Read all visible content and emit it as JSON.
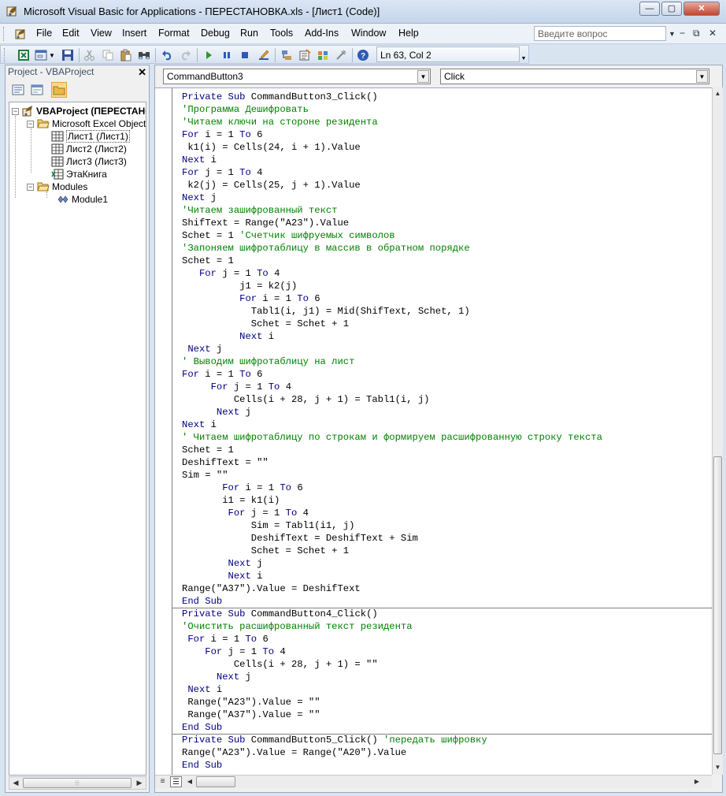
{
  "window": {
    "title": "Microsoft Visual Basic for Applications - ПЕРЕСТАНОВКА.xls - [Лист1 (Code)]",
    "minimize": "—",
    "maximize": "▢",
    "close": "✕"
  },
  "menu": {
    "items": [
      {
        "label": "File",
        "name": "menu-file"
      },
      {
        "label": "Edit",
        "name": "menu-edit"
      },
      {
        "label": "View",
        "name": "menu-view"
      },
      {
        "label": "Insert",
        "name": "menu-insert"
      },
      {
        "label": "Format",
        "name": "menu-format"
      },
      {
        "label": "Debug",
        "name": "menu-debug"
      },
      {
        "label": "Run",
        "name": "menu-run"
      },
      {
        "label": "Tools",
        "name": "menu-tools"
      },
      {
        "label": "Add-Ins",
        "name": "menu-addins"
      },
      {
        "label": "Window",
        "name": "menu-window"
      },
      {
        "label": "Help",
        "name": "menu-help"
      }
    ],
    "ask_placeholder": "Введите вопрос",
    "mdi_minimize": "−",
    "mdi_restore": "⧉",
    "mdi_close": "✕"
  },
  "toolbar": {
    "status": "Ln 63, Col 2"
  },
  "project": {
    "title": "Project - VBAProject",
    "close": "✕",
    "tree": {
      "root": "VBAProject (ПЕРЕСТАНОВКА.xls)",
      "excel_objects": "Microsoft Excel Objects",
      "sheet1": "Лист1 (Лист1)",
      "sheet2": "Лист2 (Лист2)",
      "sheet3": "Лист3 (Лист3)",
      "workbook": "ЭтаКнига",
      "modules": "Modules",
      "module1": "Module1"
    }
  },
  "code": {
    "object_select": "CommandButton3",
    "proc_select": "Click",
    "lines": [
      [
        "Private Sub CommandButton3_Click()"
      ],
      [
        "'Программа Дешифровать"
      ],
      [
        "'Читаем ключи на стороне резидента"
      ],
      [
        "For i = 1 To 6"
      ],
      [
        " k1(i) = Cells(24, i + 1).Value"
      ],
      [
        "Next i"
      ],
      [
        "For j = 1 To 4"
      ],
      [
        " k2(j) = Cells(25, j + 1).Value"
      ],
      [
        "Next j"
      ],
      [
        "'Читаем зашифрованный текст"
      ],
      [
        "ShifText = Range(\"A23\").Value"
      ],
      [
        "Schet = 1 'Счетчик шифруемых символов"
      ],
      [
        "'Запоняем шифротаблицу в массив в обратном порядке"
      ],
      [
        "Schet = 1"
      ],
      [
        "   For j = 1 To 4"
      ],
      [
        "          j1 = k2(j)"
      ],
      [
        "          For i = 1 To 6"
      ],
      [
        "            Tabl1(i, j1) = Mid(ShifText, Schet, 1)"
      ],
      [
        "            Schet = Schet + 1"
      ],
      [
        "          Next i"
      ],
      [
        " Next j"
      ],
      [
        "' Выводим шифротаблицу на лист"
      ],
      [
        "For i = 1 To 6"
      ],
      [
        "     For j = 1 To 4"
      ],
      [
        "         Cells(i + 28, j + 1) = Tabl1(i, j)"
      ],
      [
        "      Next j"
      ],
      [
        "Next i"
      ],
      [
        "' Читаем шифротаблицу по строкам и формируем расшифрованную строку текста"
      ],
      [
        "Schet = 1"
      ],
      [
        "DeshifText = \"\""
      ],
      [
        "Sim = \"\""
      ],
      [
        "       For i = 1 To 6"
      ],
      [
        "       i1 = k1(i)"
      ],
      [
        "        For j = 1 To 4"
      ],
      [
        "            Sim = Tabl1(i1, j)"
      ],
      [
        "            DeshifText = DeshifText + Sim"
      ],
      [
        "            Schet = Schet + 1"
      ],
      [
        "        Next j"
      ],
      [
        "        Next i"
      ],
      [
        "Range(\"A37\").Value = DeshifText"
      ],
      [
        "End Sub"
      ],
      [
        "Private Sub CommandButton4_Click()"
      ],
      [
        "'Очистить расшифрованный текст резидента"
      ],
      [
        " For i = 1 To 6"
      ],
      [
        "    For j = 1 To 4"
      ],
      [
        "         Cells(i + 28, j + 1) = \"\""
      ],
      [
        "      Next j"
      ],
      [
        " Next i"
      ],
      [
        " Range(\"A23\").Value = \"\""
      ],
      [
        " Range(\"A37\").Value = \"\""
      ],
      [
        "End Sub"
      ],
      [
        "Private Sub CommandButton5_Click() 'передать шифровку"
      ],
      [
        "Range(\"A23\").Value = Range(\"A20\").Value"
      ],
      [
        "End Sub"
      ]
    ]
  },
  "icons": {
    "tb_excel": "excel-icon",
    "tb_insert_form": "insert-userform-icon",
    "tb_save": "save-icon",
    "tb_cut": "cut-icon",
    "tb_copy": "copy-icon",
    "tb_paste": "paste-icon",
    "tb_find": "find-icon",
    "tb_undo": "undo-icon",
    "tb_redo": "redo-icon",
    "tb_run": "run-icon",
    "tb_break": "break-icon",
    "tb_reset": "reset-icon",
    "tb_design": "design-mode-icon",
    "tb_project": "project-explorer-icon",
    "tb_properties": "properties-icon",
    "tb_object_browser": "object-browser-icon",
    "tb_toolbox": "toolbox-icon",
    "tb_help": "help-icon"
  },
  "colors": {
    "keyword": "#00007f",
    "comment": "#007f00",
    "code_text": "#000000",
    "selection_folder": "#fbd88a"
  }
}
